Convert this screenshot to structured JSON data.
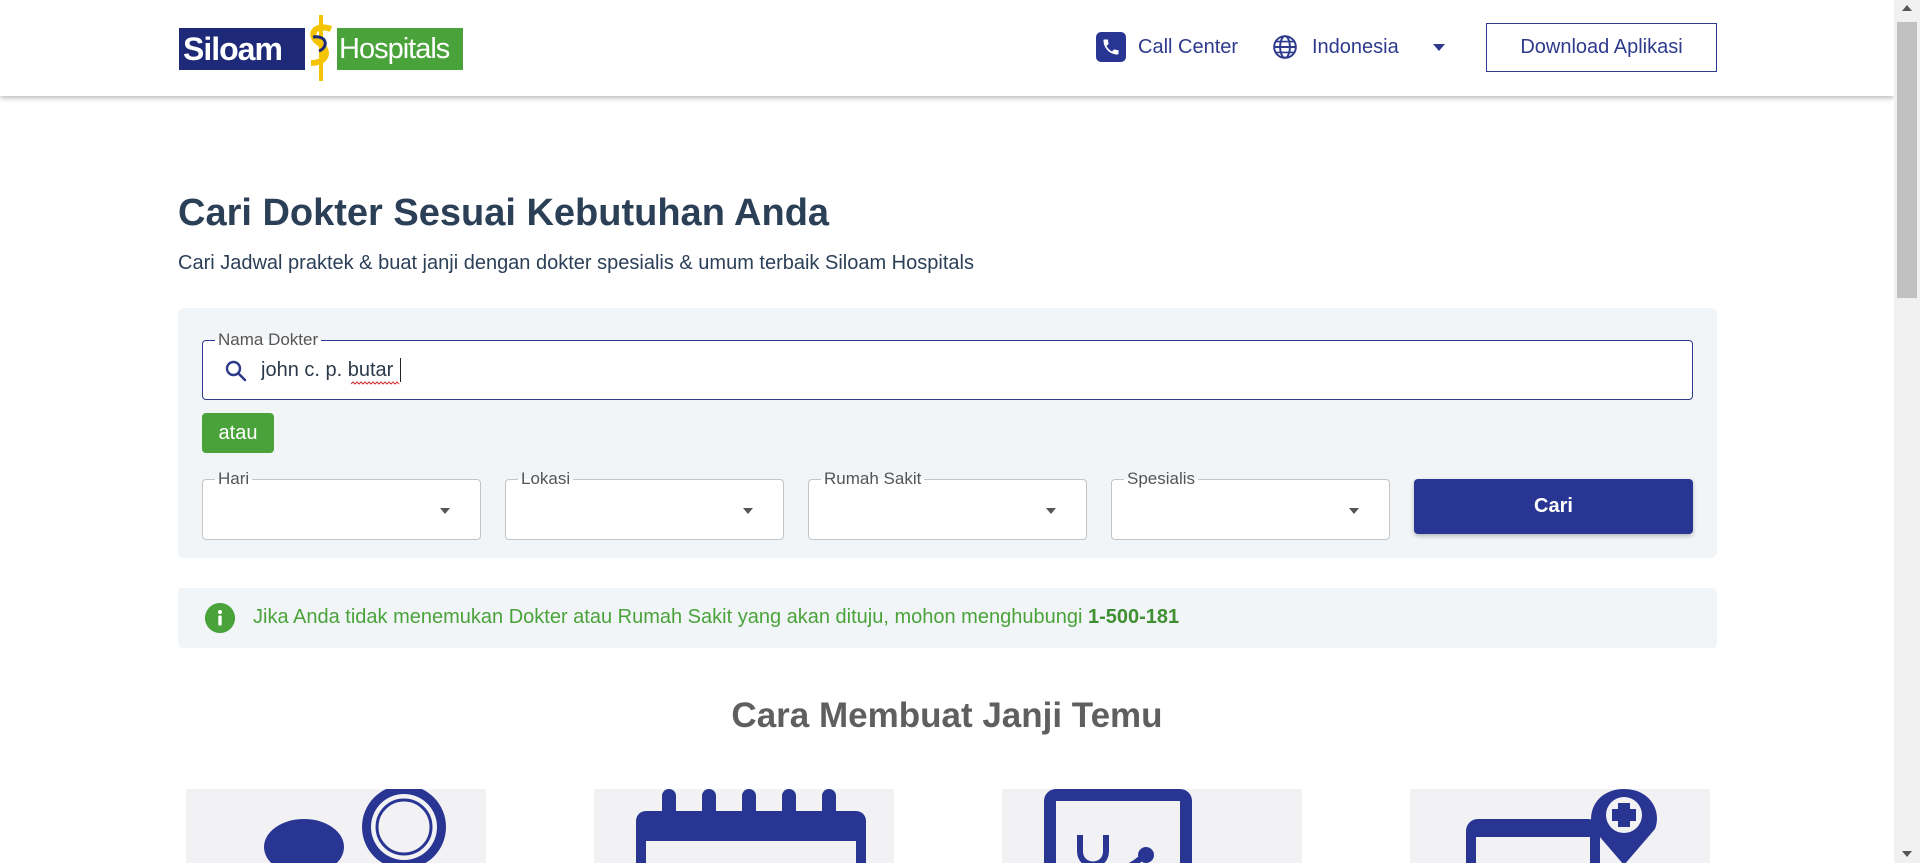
{
  "header": {
    "logo_left": "Siloam",
    "logo_right": "Hospitals",
    "call_center": "Call Center",
    "language": "Indonesia",
    "download_button": "Download Aplikasi"
  },
  "hero": {
    "title": "Cari Dokter Sesuai Kebutuhan Anda",
    "subtitle": "Cari Jadwal praktek & buat janji dengan dokter spesialis & umum terbaik Siloam Hospitals"
  },
  "search": {
    "name_label": "Nama Dokter",
    "name_value": "john c. p. butar",
    "or_badge": "atau",
    "filters": [
      {
        "label": "Hari",
        "value": ""
      },
      {
        "label": "Lokasi",
        "value": ""
      },
      {
        "label": "Rumah Sakit",
        "value": ""
      },
      {
        "label": "Spesialis",
        "value": ""
      }
    ],
    "submit_label": "Cari"
  },
  "info": {
    "text": "Jika Anda tidak menemukan Dokter atau Rumah Sakit yang akan dituju, mohon menghubungi ",
    "phone": "1-500-181"
  },
  "steps_section": {
    "title": "Cara Membuat Janji Temu",
    "icons": [
      "search-doctor-icon",
      "calendar-icon",
      "stethoscope-clipboard-icon",
      "hospital-location-icon"
    ]
  },
  "colors": {
    "primary": "#283593",
    "green": "#4aa33a",
    "panel": "#f2f5f8",
    "text": "#2b3f57"
  }
}
